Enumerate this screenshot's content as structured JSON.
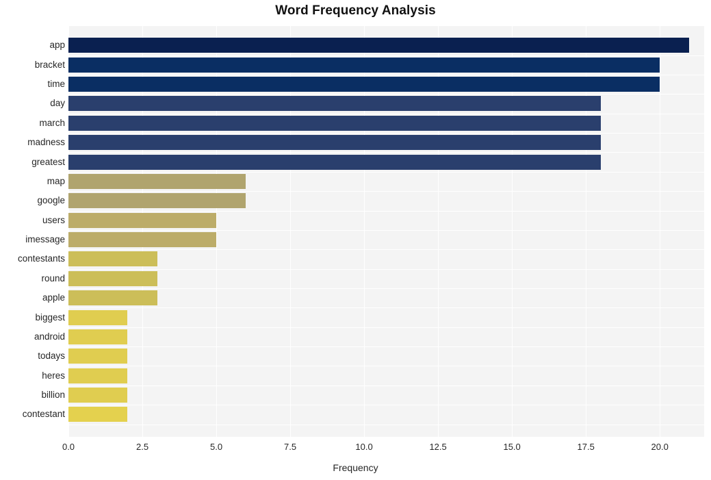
{
  "chart_data": {
    "type": "bar",
    "orientation": "horizontal",
    "title": "Word Frequency Analysis",
    "xlabel": "Frequency",
    "ylabel": "",
    "xlim": [
      0,
      21.5
    ],
    "xticks": [
      "0.0",
      "2.5",
      "5.0",
      "7.5",
      "10.0",
      "12.5",
      "15.0",
      "17.5",
      "20.0"
    ],
    "xtick_values": [
      0,
      2.5,
      5,
      7.5,
      10,
      12.5,
      15,
      17.5,
      20
    ],
    "grid": true,
    "legend": "none",
    "categories": [
      "app",
      "bracket",
      "time",
      "day",
      "march",
      "madness",
      "greatest",
      "map",
      "google",
      "users",
      "imessage",
      "contestants",
      "round",
      "apple",
      "biggest",
      "android",
      "todays",
      "heres",
      "billion",
      "contestant"
    ],
    "values": [
      21,
      20,
      20,
      18,
      18,
      18,
      18,
      6,
      6,
      5,
      5,
      3,
      3,
      3,
      2,
      2,
      2,
      2,
      2,
      2
    ],
    "bar_colors": [
      "#0a2050",
      "#0a2e63",
      "#0a2e63",
      "#2a3f6d",
      "#2a3f6d",
      "#2a3f6d",
      "#2a3f6d",
      "#b0a46e",
      "#b0a46e",
      "#bcac69",
      "#bcac69",
      "#ccbe59",
      "#ccbe59",
      "#ccbe59",
      "#e0cd50",
      "#e0cd50",
      "#e0cd50",
      "#e0cd50",
      "#e0cd50",
      "#e4d14e"
    ],
    "plot_background": "#f4f4f4",
    "gridline_color": "#ffffff",
    "text_color": "#262626"
  }
}
